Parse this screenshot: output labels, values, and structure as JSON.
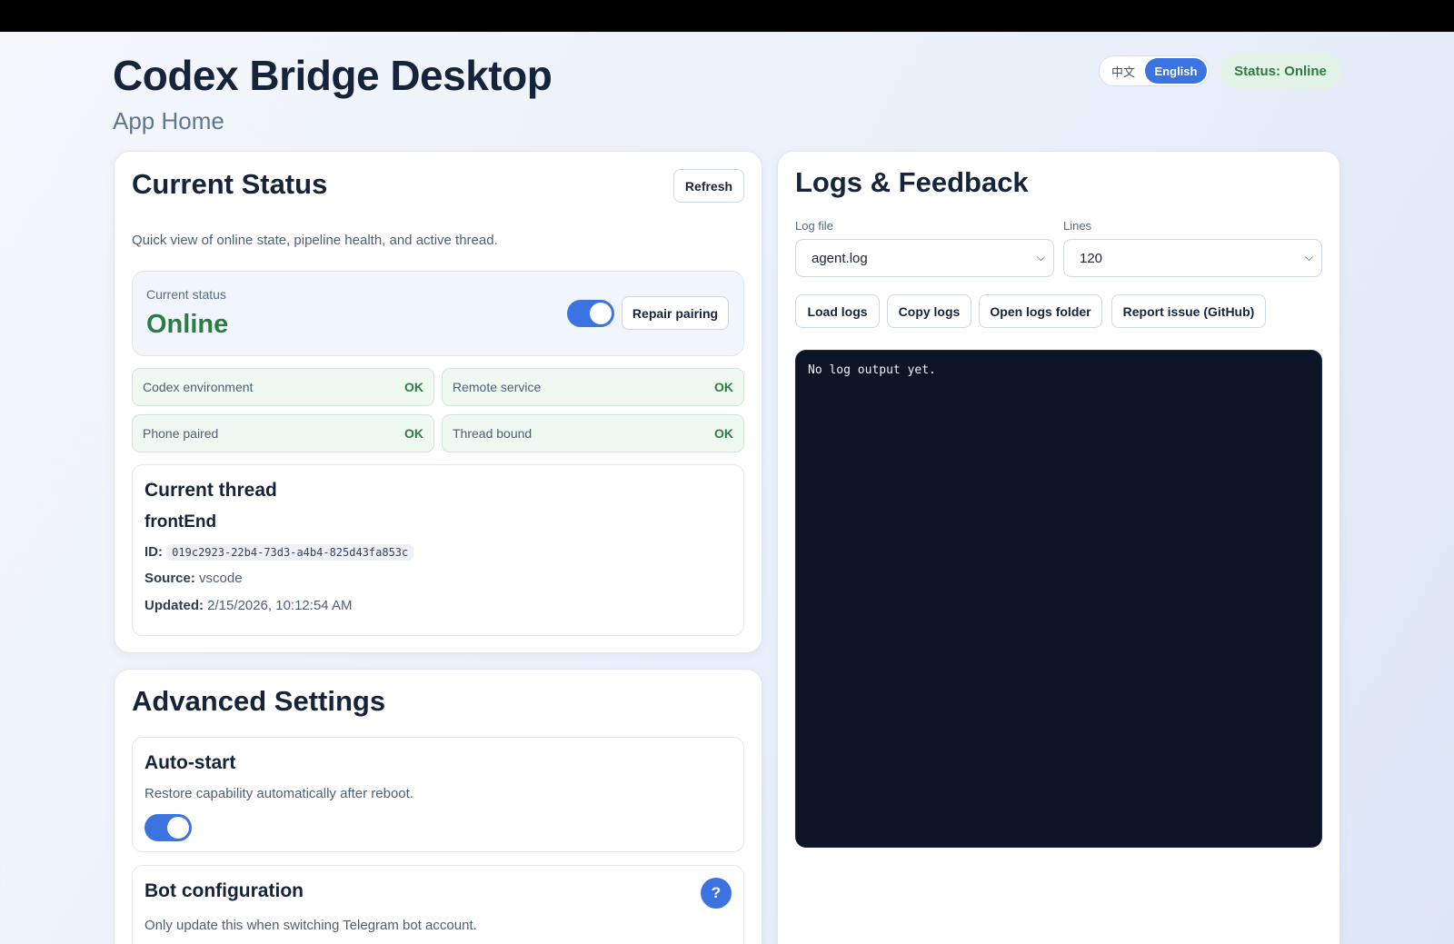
{
  "header": {
    "title": "Codex Bridge Desktop",
    "subtitle": "App Home",
    "lang_zh": "中文",
    "lang_en": "English",
    "status_pill": "Status: Online"
  },
  "status_card": {
    "title": "Current Status",
    "refresh_label": "Refresh",
    "description": "Quick view of online state, pipeline health, and active thread.",
    "current_status_label": "Current status",
    "current_status_value": "Online",
    "online_toggle_on": true,
    "repair_label": "Repair pairing",
    "checks": [
      {
        "name": "Codex environment",
        "state": "OK"
      },
      {
        "name": "Remote service",
        "state": "OK"
      },
      {
        "name": "Phone paired",
        "state": "OK"
      },
      {
        "name": "Thread bound",
        "state": "OK"
      }
    ],
    "thread": {
      "heading": "Current thread",
      "name": "frontEnd",
      "id_label": "ID:",
      "id_value": "019c2923-22b4-73d3-a4b4-825d43fa853c",
      "source_label": "Source:",
      "source_value": "vscode",
      "updated_label": "Updated:",
      "updated_value": "2/15/2026, 10:12:54 AM"
    }
  },
  "advanced": {
    "title": "Advanced Settings",
    "autostart": {
      "heading": "Auto-start",
      "description": "Restore capability automatically after reboot.",
      "enabled": true
    },
    "bot": {
      "heading": "Bot configuration",
      "description": "Only update this when switching Telegram bot account.",
      "help_icon": "?"
    }
  },
  "logs": {
    "title": "Logs & Feedback",
    "log_file_label": "Log file",
    "log_file_value": "agent.log",
    "lines_label": "Lines",
    "lines_value": "120",
    "buttons": {
      "load": "Load logs",
      "copy": "Copy logs",
      "open_folder": "Open logs folder",
      "report": "Report issue (GitHub)"
    },
    "output": "No log output yet."
  },
  "colors": {
    "accent": "#3b73e0",
    "ok_green": "#2d7b45",
    "terminal_bg": "#0c1426"
  }
}
